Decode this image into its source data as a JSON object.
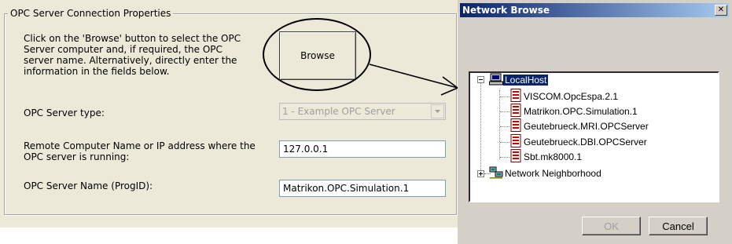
{
  "left_panel": {
    "group_title": "OPC Server Connection Properties",
    "instructions": "Click on the 'Browse' button to select the OPC\nServer computer and, if required, the OPC\nserver name. Alternatively, directly enter the\ninformation in the fields below.",
    "browse_label": "Browse",
    "server_type_label": "OPC Server type:",
    "server_type_value": "1 - Example OPC Server",
    "remote_label": "Remote Computer Name or IP address where the\nOPC server is running:",
    "remote_value": "127.0.0.1",
    "progid_label": "OPC Server Name (ProgID):",
    "progid_value": "Matrikon.OPC.Simulation.1"
  },
  "dialog": {
    "title": "Network Browse",
    "close_glyph": "✕",
    "tree": {
      "root": "LocalHost",
      "servers": [
        "VISCOM.OpcEspa.2.1",
        "Matrikon.OPC.Simulation.1",
        "Geutebrueck.MRI.OPCServer",
        "Geutebrueck.DBI.OPCServer",
        "Sbt.mk8000.1"
      ],
      "network": "Network Neighborhood"
    },
    "ok_label": "OK",
    "cancel_label": "Cancel"
  },
  "icons": {
    "computer": "computer-icon",
    "opc_server": "opc-server-icon",
    "network": "network-neighborhood-icon",
    "close": "close-icon",
    "dropdown": "chevron-down-icon"
  },
  "colors": {
    "titlebar_start": "#0a246a",
    "titlebar_end": "#a6caf0",
    "selection": "#0a246a",
    "panel_bg": "#ece9d8",
    "dialog_bg": "#d4d0c8"
  }
}
